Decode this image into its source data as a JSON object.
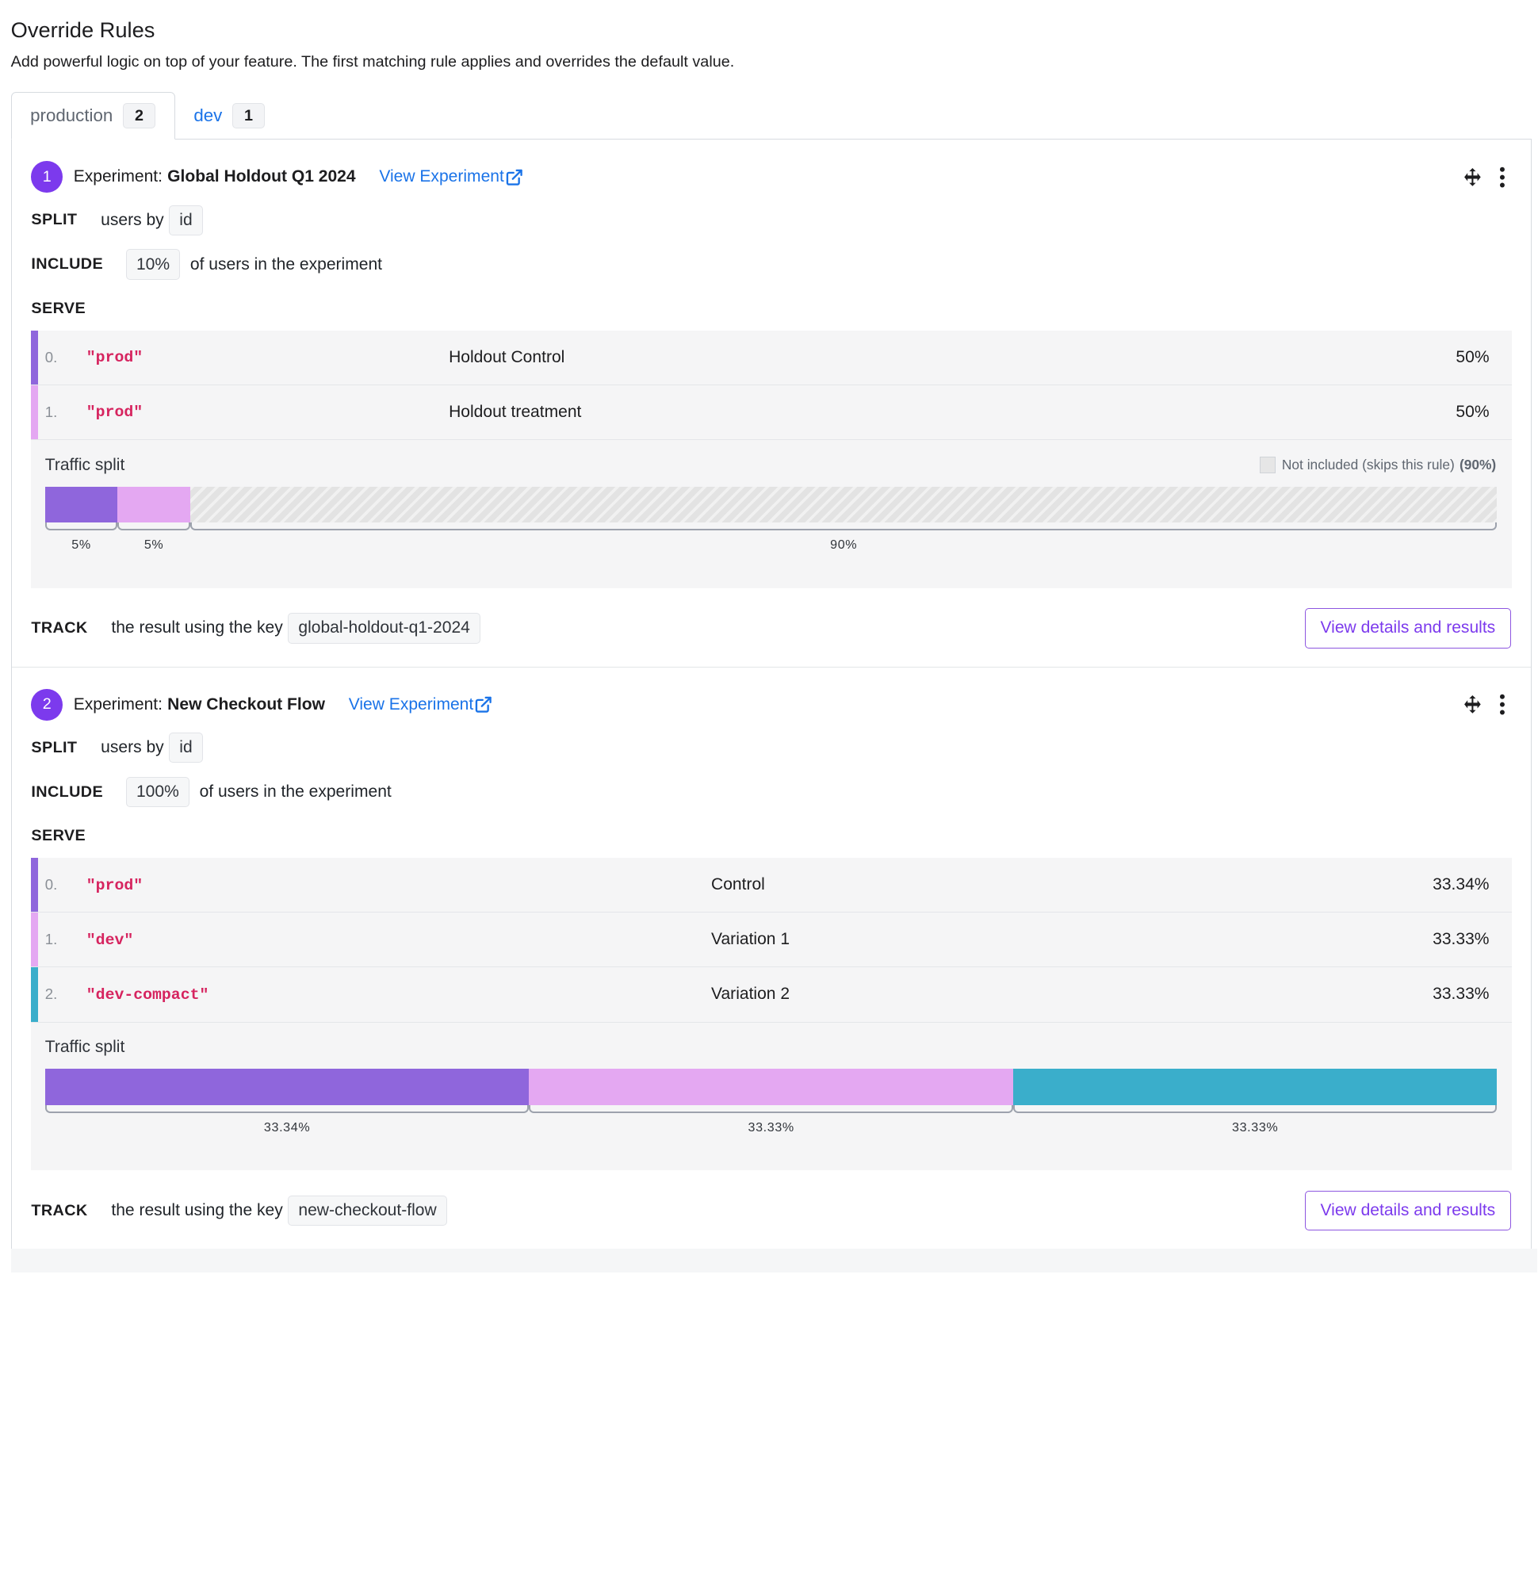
{
  "header": {
    "title": "Override Rules",
    "subtitle": "Add powerful logic on top of your feature. The first matching rule applies and overrides the default value."
  },
  "tabs": [
    {
      "label": "production",
      "count": "2",
      "active": true
    },
    {
      "label": "dev",
      "count": "1",
      "active": false
    }
  ],
  "common": {
    "experiment_prefix": "Experiment:",
    "view_experiment": "View Experiment",
    "split_kw": "SPLIT",
    "split_text": "users by",
    "include_kw": "INCLUDE",
    "include_text": "of users in the experiment",
    "serve_kw": "SERVE",
    "traffic_title": "Traffic split",
    "track_kw": "TRACK",
    "track_text": "the result using the key",
    "details_button": "View details and results"
  },
  "rules": [
    {
      "number": "1",
      "name": "Global Holdout Q1 2024",
      "split_attr": "id",
      "include_pct": "10%",
      "variations": [
        {
          "index": "0.",
          "value": "\"prod\"",
          "name": "Holdout Control",
          "pct": "50%"
        },
        {
          "index": "1.",
          "value": "\"prod\"",
          "name": "Holdout treatment",
          "pct": "50%"
        }
      ],
      "legend": {
        "label": "Not included (skips this rule)",
        "pct": "(90%)"
      },
      "split_labels": [
        "5%",
        "5%",
        "90%"
      ],
      "track_key": "global-holdout-q1-2024"
    },
    {
      "number": "2",
      "name": "New Checkout Flow",
      "split_attr": "id",
      "include_pct": "100%",
      "variations": [
        {
          "index": "0.",
          "value": "\"prod\"",
          "name": "Control",
          "pct": "33.34%"
        },
        {
          "index": "1.",
          "value": "\"dev\"",
          "name": "Variation 1",
          "pct": "33.33%"
        },
        {
          "index": "2.",
          "value": "\"dev-compact\"",
          "name": "Variation 2",
          "pct": "33.33%"
        }
      ],
      "split_labels": [
        "33.34%",
        "33.33%",
        "33.33%"
      ],
      "track_key": "new-checkout-flow"
    }
  ],
  "traffic": {
    "rule1_segments": [
      0.05,
      0.05,
      0.9
    ],
    "rule2_segments": [
      0.3334,
      0.3333,
      0.3333
    ]
  },
  "colors": {
    "variation_0": "#8f66dc",
    "variation_1": "#e4a8f2",
    "variation_2": "#3aaecb",
    "accent": "#7c3aed",
    "link": "#1a73e8",
    "value_text": "#d6245f"
  },
  "icons": {
    "external_link": "external-link-icon",
    "drag": "drag-move-icon",
    "menu": "more-vertical-icon"
  }
}
